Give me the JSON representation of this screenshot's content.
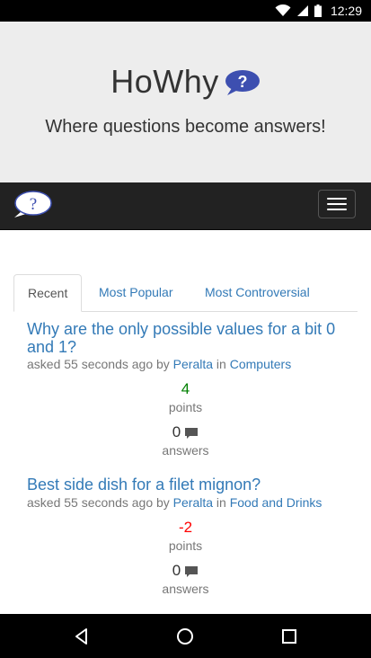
{
  "status_bar": {
    "time": "12:29",
    "icons": [
      "wifi-icon",
      "cell-signal-icon",
      "battery-icon"
    ]
  },
  "header": {
    "brand": "HoWhy",
    "tagline": "Where questions become answers!",
    "logo_icon": "question-bubble-icon"
  },
  "navbar": {
    "logo_icon": "question-bubble-icon",
    "menu_icon": "hamburger-menu-icon"
  },
  "tabs": [
    {
      "label": "Recent",
      "active": true
    },
    {
      "label": "Most Popular",
      "active": false
    },
    {
      "label": "Most Controversial",
      "active": false
    }
  ],
  "questions": [
    {
      "title": "Why are the only possible values for a bit 0 and 1?",
      "meta_prefix": "asked 55 seconds ago by ",
      "author": "Peralta",
      "meta_in": " in ",
      "category": "Computers",
      "score": "4",
      "score_color": "#008000",
      "points_label": "points",
      "answers": "0",
      "answers_label": "answers"
    },
    {
      "title": "Best side dish for a filet mignon?",
      "meta_prefix": "asked 55 seconds ago by ",
      "author": "Peralta",
      "meta_in": " in ",
      "category": "Food and Drinks",
      "score": "-2",
      "score_color": "#ff0000",
      "points_label": "points",
      "answers": "0",
      "answers_label": "answers"
    }
  ],
  "system_nav": {
    "icons": [
      "back-icon",
      "home-icon",
      "recents-icon"
    ]
  },
  "colors": {
    "link": "#337ab7",
    "navbar": "#222222",
    "jumbotron": "#ededed",
    "bubble": "#3d4fb0"
  }
}
